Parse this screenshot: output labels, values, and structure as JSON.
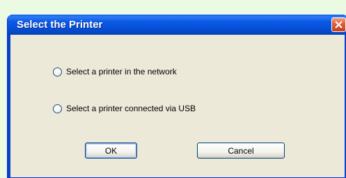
{
  "dialog": {
    "title": "Select the Printer",
    "options": [
      {
        "label": "Select a printer in the network",
        "selected": false
      },
      {
        "label": "Select a printer connected via USB",
        "selected": false
      }
    ],
    "ok_label": "OK",
    "cancel_label": "Cancel"
  },
  "colors": {
    "background": "#eafae3",
    "titlebar": "#0652dd",
    "dialog_face": "#ece9d8",
    "close_button": "#e2603a"
  },
  "icons": {
    "close": "close-icon"
  }
}
